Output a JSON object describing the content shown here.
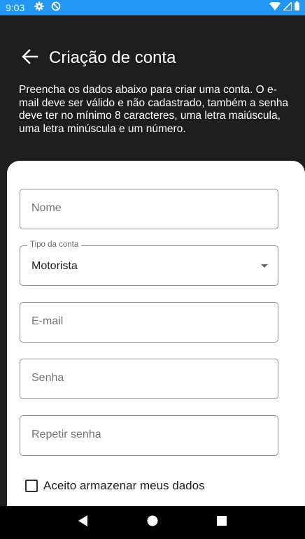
{
  "status_bar": {
    "time": "9:03",
    "left_icons": [
      "settings-icon",
      "sync-icon"
    ],
    "right_icons": [
      "wifi-icon",
      "signal-icon",
      "battery-icon"
    ],
    "color": "#2196f3"
  },
  "header": {
    "title": "Criação de conta",
    "description": "Preencha os dados abaixo para criar uma conta. O e-mail deve ser válido e não cadastrado, também a senha deve ter no mínimo 8 caracteres, uma letra maiúscula, uma letra minúscula e um número."
  },
  "form": {
    "name_placeholder": "Nome",
    "account_type_label": "Tipo da conta",
    "account_type_value": "Motorista",
    "email_placeholder": "E-mail",
    "password_placeholder": "Senha",
    "repeat_password_placeholder": "Repetir senha",
    "consent_label": "Aceito armazenar meus dados",
    "consent_checked": false
  },
  "nav_bar": {
    "buttons": [
      "back-icon",
      "home-icon",
      "recents-icon"
    ]
  }
}
